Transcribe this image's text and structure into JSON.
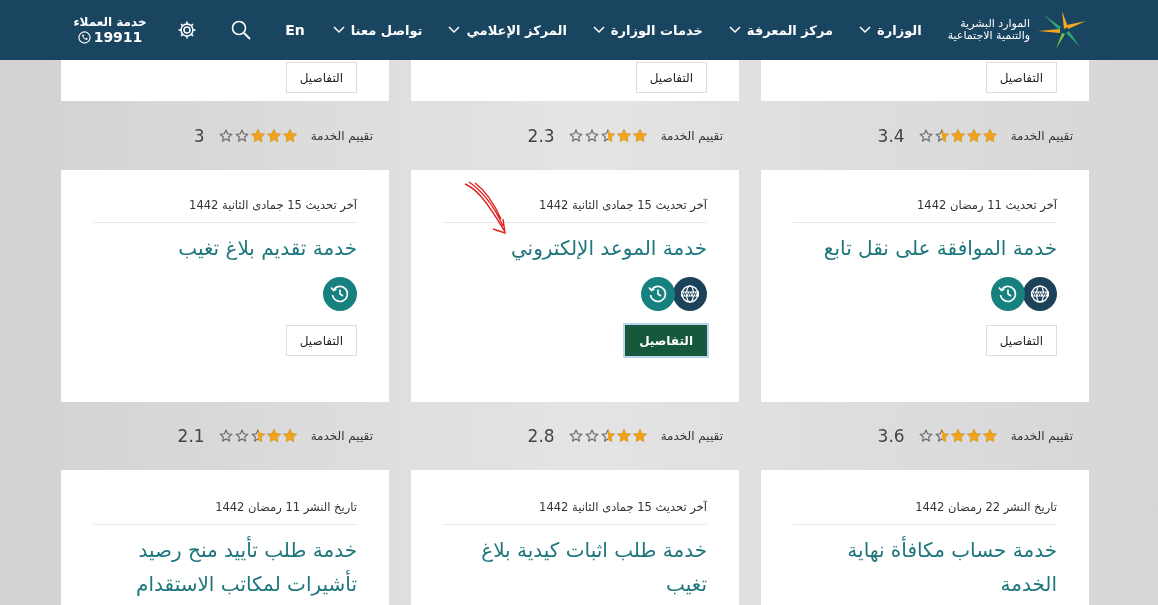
{
  "header": {
    "logo": {
      "line_1": "الموارد البشرية",
      "line_2": "والتنمية الاجتماعية"
    },
    "nav": [
      {
        "label": "الوزارة"
      },
      {
        "label": "مركز المعرفة"
      },
      {
        "label": "خدمات الوزارة"
      },
      {
        "label": "المركز الإعلامي"
      },
      {
        "label": "تواصل معنا"
      }
    ],
    "language": "En",
    "customer_service": {
      "label": "خدمة العملاء",
      "phone": "19911"
    }
  },
  "rows": [
    {
      "cards": [
        {
          "details": {
            "label": "التفاصيل",
            "selected": false
          },
          "rating": {
            "label": "تقييم الخدمة",
            "stars": 3.5,
            "value": "3.4"
          }
        },
        {
          "details": {
            "label": "التفاصيل",
            "selected": false
          },
          "rating": {
            "label": "تقييم الخدمة",
            "stars": 2.5,
            "value": "2.3"
          }
        },
        {
          "details": {
            "label": "التفاصيل",
            "selected": false
          },
          "rating": {
            "label": "تقييم الخدمة",
            "stars": 3,
            "value": "3"
          }
        }
      ]
    },
    {
      "cards": [
        {
          "date": "آخر تحديث 11 رمضان 1442",
          "title": "خدمة الموافقة على نقل تابع",
          "marked": false,
          "icons": [
            {
              "kind": "web"
            },
            {
              "kind": "history"
            }
          ],
          "details": {
            "label": "التفاصيل",
            "selected": false
          },
          "rating": {
            "label": "تقييم الخدمة",
            "stars": 3.5,
            "value": "3.6"
          }
        },
        {
          "date": "آخر تحديث 15 جمادى الثانية 1442",
          "title": "خدمة الموعد الإلكتروني",
          "marked": true,
          "icons": [
            {
              "kind": "web"
            },
            {
              "kind": "history"
            }
          ],
          "details": {
            "label": "التفاصيل",
            "selected": true
          },
          "rating": {
            "label": "تقييم الخدمة",
            "stars": 2.5,
            "value": "2.8"
          }
        },
        {
          "date": "آخر تحديث 15 جمادى الثانية 1442",
          "title": "خدمة تقديم بلاغ تغيب",
          "marked": false,
          "icons": [
            {
              "kind": "history"
            }
          ],
          "details": {
            "label": "التفاصيل",
            "selected": false
          },
          "rating": {
            "label": "تقييم الخدمة",
            "stars": 2.5,
            "value": "2.1"
          }
        }
      ]
    },
    {
      "cards": [
        {
          "date": "تاريخ النشر 22 رمضان 1442",
          "title": "خدمة حساب مكافأة نهاية الخدمة"
        },
        {
          "date": "آخر تحديث 15 جمادى الثانية 1442",
          "title": "خدمة طلب اثبات كيدية بلاغ تغيب"
        },
        {
          "date": "تاريخ النشر 11 رمضان 1442",
          "title": "خدمة طلب تأييد منح رصيد تأشيرات لمكاتب الاستقدام"
        }
      ]
    }
  ]
}
